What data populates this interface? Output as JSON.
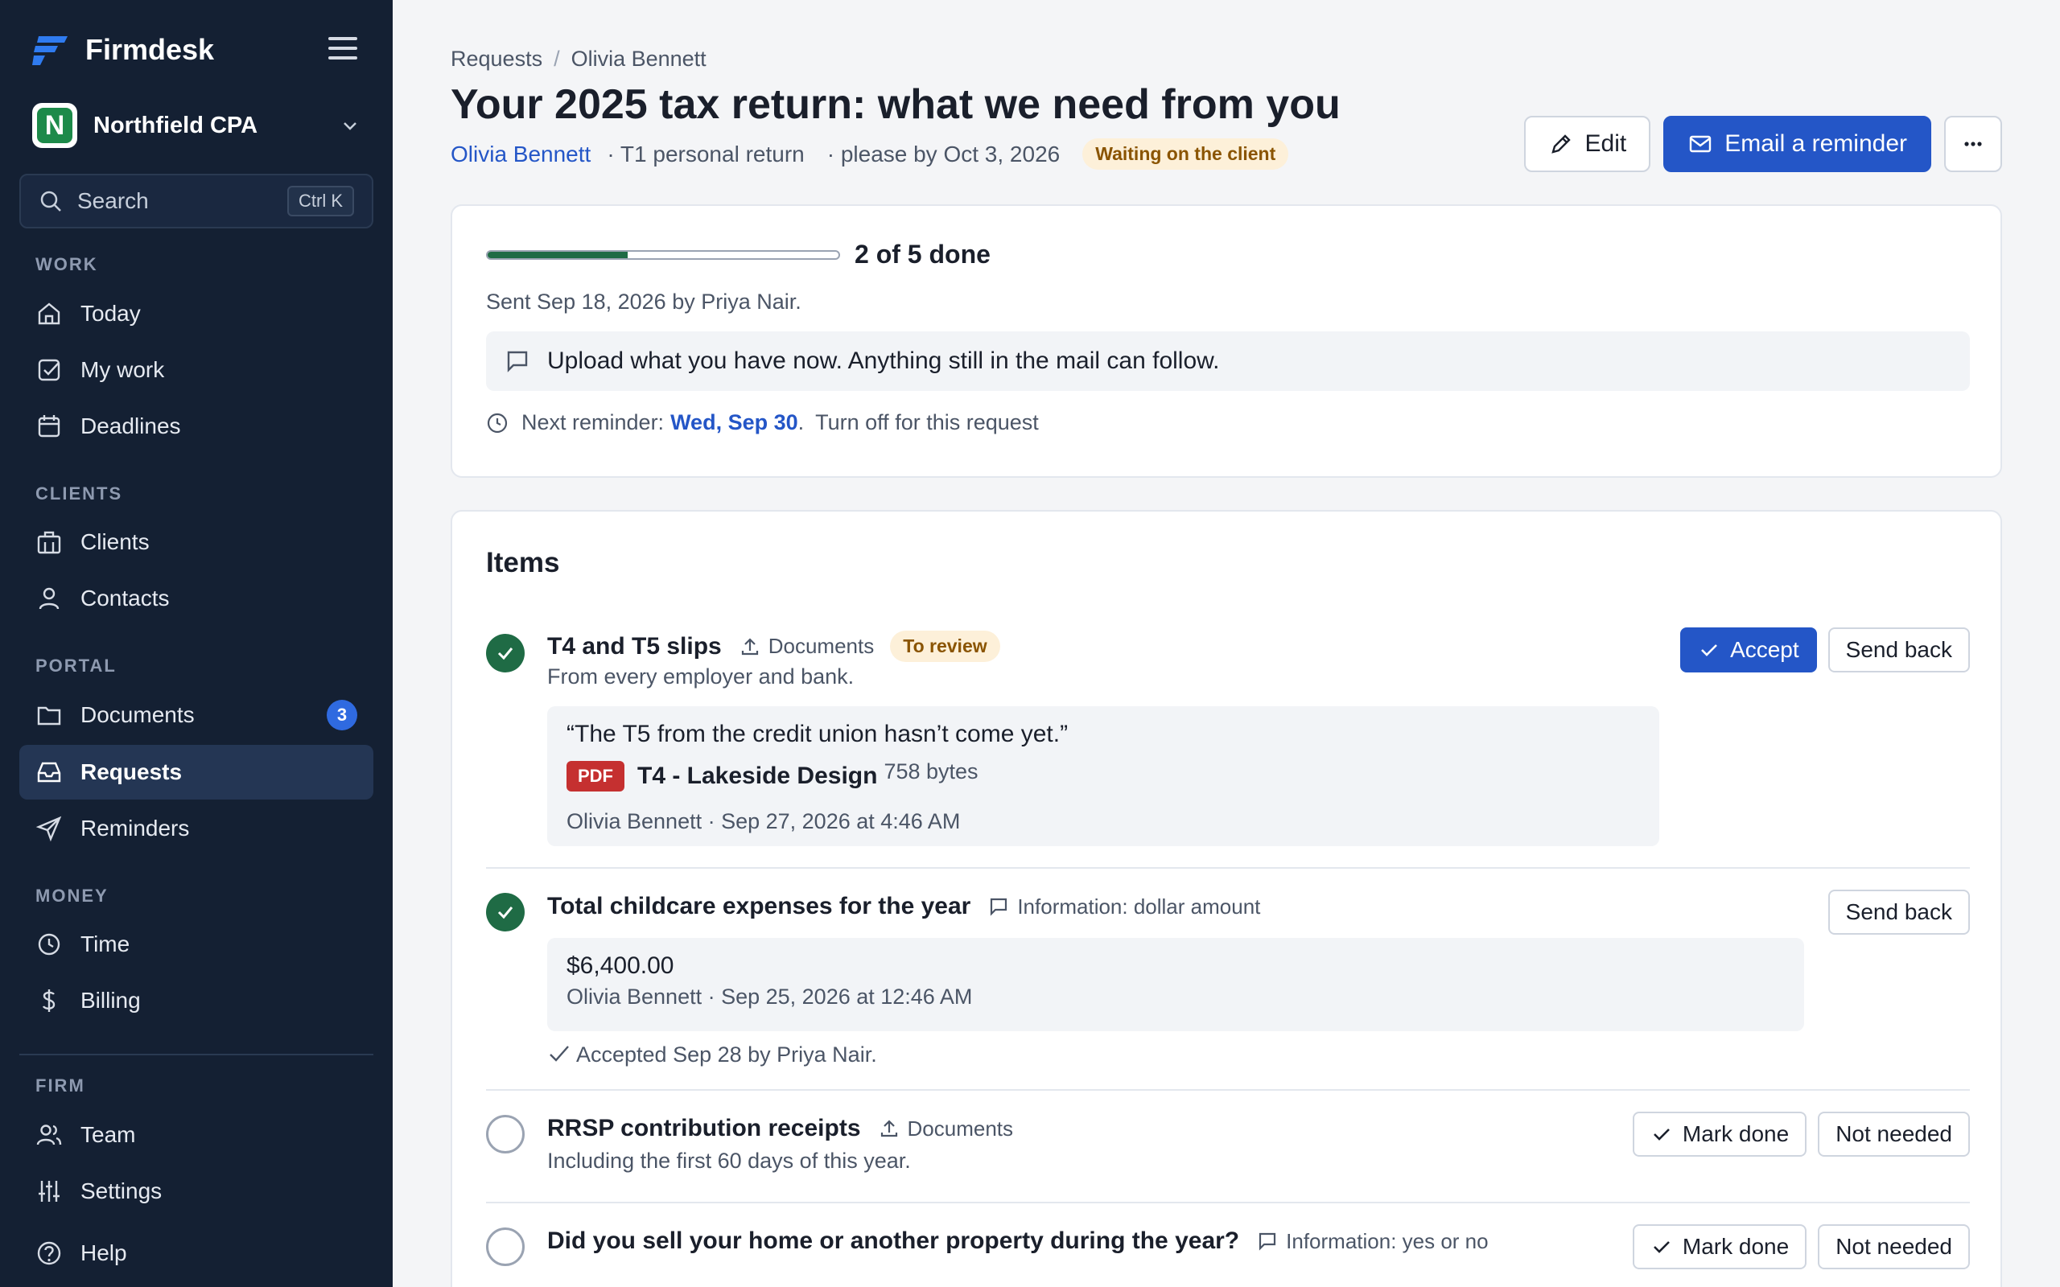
{
  "app": {
    "name": "Firmdesk"
  },
  "org": {
    "name": "Northfield CPA",
    "initial": "N"
  },
  "search": {
    "label": "Search",
    "shortcut": "Ctrl K"
  },
  "nav": {
    "work": {
      "label": "WORK",
      "items": [
        "Today",
        "My work",
        "Deadlines"
      ]
    },
    "clients": {
      "label": "CLIENTS",
      "items": [
        "Clients",
        "Contacts"
      ]
    },
    "portal": {
      "label": "PORTAL",
      "items": [
        "Documents",
        "Requests",
        "Reminders"
      ],
      "documents_badge": "3"
    },
    "money": {
      "label": "MONEY",
      "items": [
        "Time",
        "Billing"
      ]
    },
    "firm": {
      "label": "FIRM",
      "items": [
        "Team",
        "Settings"
      ]
    },
    "help": "Help"
  },
  "header": {
    "breadcrumb": [
      "Requests",
      "Olivia Bennett"
    ],
    "title": "Your 2025 tax return: what we need from you",
    "client": "Olivia Bennett",
    "type": "· T1 personal return",
    "due": "· please by Oct 3, 2026",
    "status": "Waiting on the client",
    "edit_label": "Edit",
    "remind_label": "Email a reminder"
  },
  "summary": {
    "progress_fraction": 0.4,
    "progress_label": "2 of 5 done",
    "sent": "Sent Sep 18, 2026 by Priya Nair.",
    "note": "Upload what you have now. Anything still in the mail can follow.",
    "reminder_prefix": "Next reminder:",
    "reminder_date": "Wed, Sep 30",
    "reminder_off": "Turn off for this request"
  },
  "items": {
    "title": "Items",
    "list": [
      {
        "name": "T4 and T5 slips",
        "kind": "Documents",
        "status": "To review",
        "description": "From every employer and bank.",
        "quote": "“The T5 from the credit union hasn’t come yet.”",
        "file_type": "PDF",
        "file_name": "T4 - Lakeside Design",
        "file_size": "758 bytes",
        "byline": "Olivia Bennett · Sep 27, 2026 at 4:46 AM",
        "accept_label": "Accept",
        "send_back_label": "Send back"
      },
      {
        "name": "Total childcare expenses for the year",
        "kind": "Information: dollar amount",
        "value": "$6,400.00",
        "byline": "Olivia Bennett · Sep 25, 2026 at 12:46 AM",
        "accepted": "Accepted Sep 28 by Priya Nair.",
        "send_back_label": "Send back"
      },
      {
        "name": "RRSP contribution receipts",
        "kind": "Documents",
        "description": "Including the first 60 days of this year.",
        "mark_done_label": "Mark done",
        "not_needed_label": "Not needed"
      },
      {
        "name": "Did you sell your home or another property during the year?",
        "kind": "Information: yes or no",
        "mark_done_label": "Mark done",
        "not_needed_label": "Not needed"
      }
    ]
  },
  "colors": {
    "sidebar": "#142033",
    "primary": "#2456c7",
    "success": "#1f6b45",
    "warning_bg": "#fdf0d9"
  }
}
